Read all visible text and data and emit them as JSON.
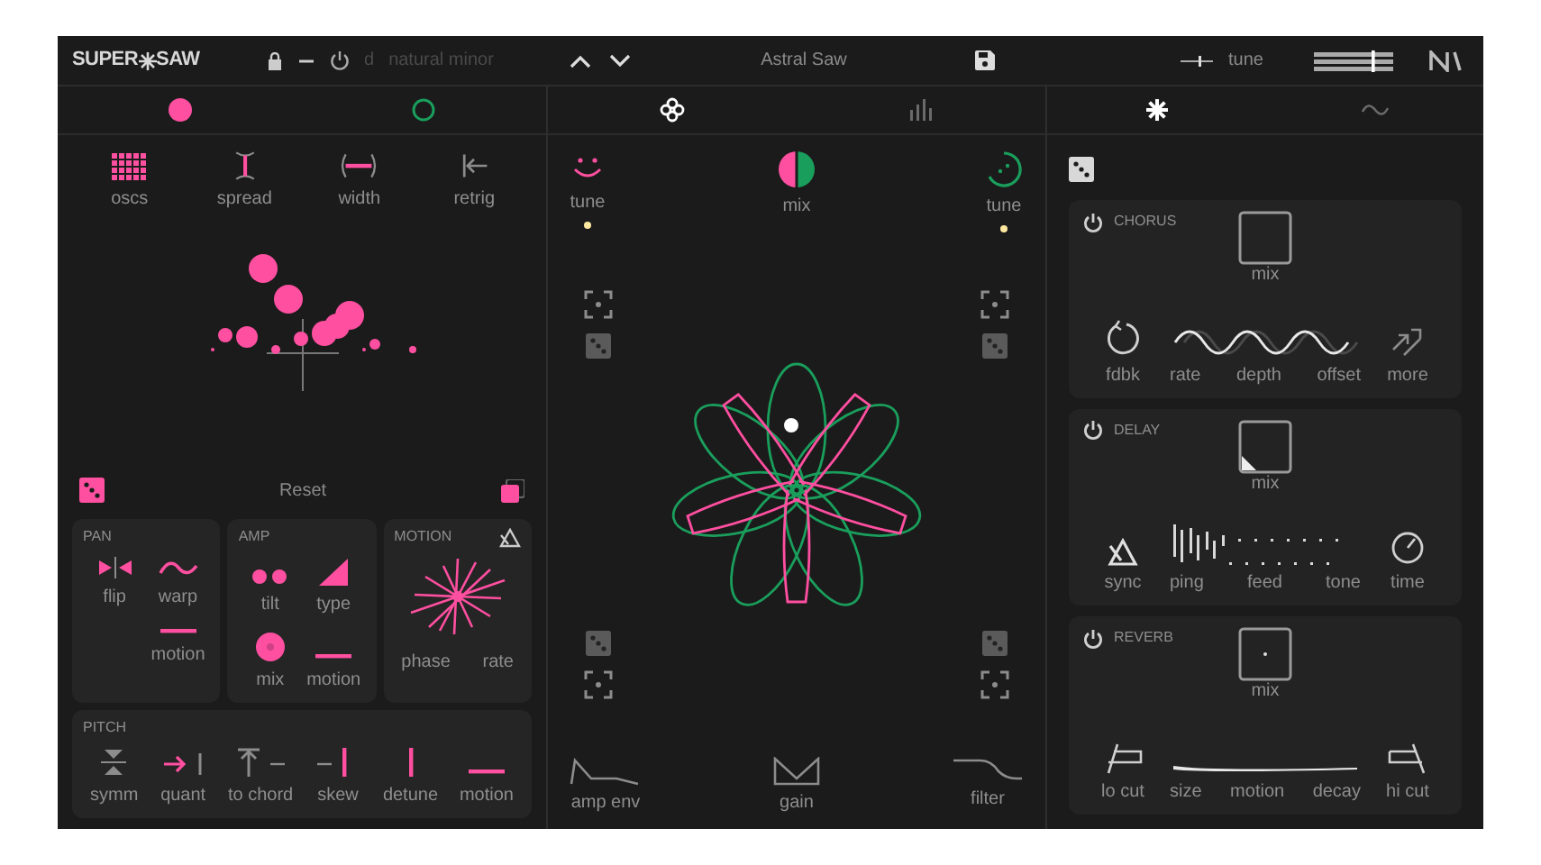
{
  "header": {
    "logo": [
      "SUPER",
      "SAW"
    ],
    "scale": {
      "key": "d",
      "name": "natural minor",
      "disabled": true
    },
    "preset": "Astral Saw",
    "tune_label": "tune"
  },
  "osc_tabs": [
    {
      "color": "#ff4fa0",
      "selected": true
    },
    {
      "color": "#1a9e5c",
      "selected": false
    }
  ],
  "view_tabs": [
    {
      "selected": true
    },
    {
      "selected": false
    }
  ],
  "fx_tabs": [
    {
      "selected": true
    },
    {
      "selected": false
    }
  ],
  "osc": {
    "controls": [
      "oscs",
      "spread",
      "width",
      "retrig"
    ],
    "reset": "Reset",
    "sections": [
      {
        "title": "PAN",
        "kind": "grid",
        "controls": [
          "flip",
          "warp",
          "motion"
        ]
      },
      {
        "title": "AMP",
        "kind": "grid",
        "controls": [
          "tilt",
          "type",
          "mix",
          "motion"
        ]
      },
      {
        "title": "MOTION",
        "kind": "burst",
        "controls": [
          "phase",
          "rate"
        ]
      },
      {
        "title": "PITCH",
        "kind": "row",
        "controls": [
          "symm",
          "quant",
          "to chord",
          "skew",
          "detune",
          "motion"
        ]
      }
    ]
  },
  "mixer": {
    "top": [
      {
        "label": "tune",
        "indicator": true
      },
      {
        "label": "mix"
      },
      {
        "label": "tune",
        "indicator": true
      }
    ],
    "bottom": [
      "amp env",
      "gain",
      "filter"
    ]
  },
  "effects": [
    {
      "title": "CHORUS",
      "mix": "mix",
      "controls": [
        "fdbk",
        "rate",
        "depth",
        "offset",
        "more"
      ]
    },
    {
      "title": "DELAY",
      "mix": "mix",
      "controls": [
        "sync",
        "ping",
        "feed",
        "tone",
        "time"
      ]
    },
    {
      "title": "REVERB",
      "mix": "mix",
      "controls": [
        "lo cut",
        "size",
        "motion",
        "decay",
        "hi cut"
      ]
    }
  ]
}
